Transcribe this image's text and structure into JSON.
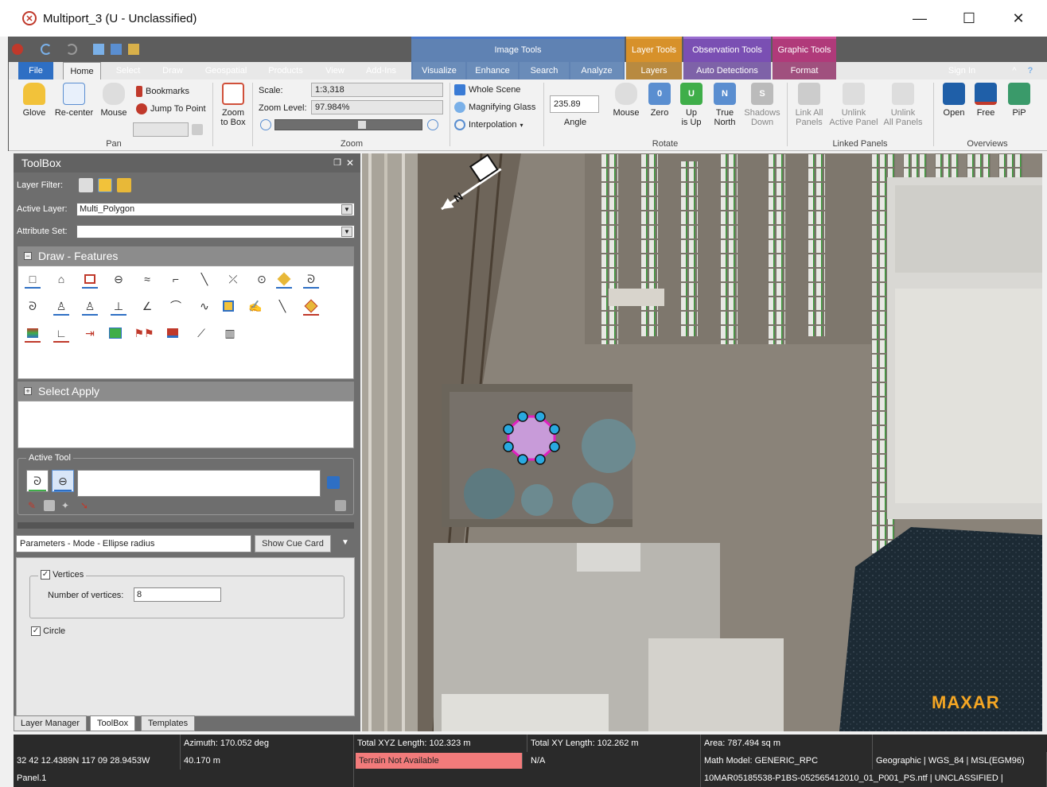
{
  "window": {
    "title": "Multiport_3 (U - Unclassified)",
    "minimize": "—",
    "maximize": "☐",
    "close": "✕"
  },
  "ribbon": {
    "context_groups": {
      "image_tools": "Image Tools",
      "layer_tools": "Layer Tools",
      "observation_tools": "Observation Tools",
      "graphic_tools": "Graphic Tools"
    },
    "tabs": [
      "File",
      "Home",
      "Select",
      "Draw",
      "Geospatial",
      "Products",
      "View",
      "Add-Ins",
      "Visualize",
      "Enhance",
      "Search",
      "Analyze",
      "Layers",
      "Auto Detections",
      "Format"
    ],
    "sign_in": "Sign In",
    "pan": {
      "label": "Pan",
      "glove": "Glove",
      "recenter": "Re-center",
      "mouse": "Mouse",
      "bookmarks": "Bookmarks",
      "jump_to_point": "Jump To Point"
    },
    "zoom": {
      "label": "Zoom",
      "zoom_to_box_1": "Zoom",
      "zoom_to_box_2": "to Box",
      "scale_label": "Scale:",
      "scale_value": "1:3,318",
      "zoom_level_label": "Zoom Level:",
      "zoom_level_value": "97.984%"
    },
    "view": {
      "whole_scene": "Whole Scene",
      "magnifying_glass": "Magnifying Glass",
      "interpolation": "Interpolation"
    },
    "rotate": {
      "label": "Rotate",
      "angle_value": "235.89",
      "angle": "Angle",
      "mouse": "Mouse",
      "zero": "Zero",
      "up_is_up_1": "Up",
      "up_is_up_2": "is Up",
      "true_north_1": "True",
      "true_north_2": "North",
      "shadows_down_1": "Shadows",
      "shadows_down_2": "Down"
    },
    "linked_panels": {
      "label": "Linked Panels",
      "link_all_1": "Link All",
      "link_all_2": "Panels",
      "unlink_active_1": "Unlink",
      "unlink_active_2": "Active Panel",
      "unlink_all_1": "Unlink",
      "unlink_all_2": "All Panels"
    },
    "overviews": {
      "label": "Overviews",
      "open": "Open",
      "free": "Free",
      "pip": "PiP"
    }
  },
  "toolbox": {
    "title": "ToolBox",
    "layer_filter_label": "Layer Filter:",
    "active_layer_label": "Active Layer:",
    "active_layer_value": "Multi_Polygon",
    "attribute_set_label": "Attribute Set:",
    "attribute_set_value": "",
    "draw_features": "Draw - Features",
    "select_apply": "Select Apply",
    "active_tool": "Active Tool",
    "parameters": "Parameters - Mode - Ellipse radius",
    "show_cue_card": "Show Cue Card",
    "vertices_label": "Vertices",
    "number_of_vertices_label": "Number of vertices:",
    "number_of_vertices_value": "8",
    "circle_label": "Circle"
  },
  "bottom_tabs": [
    "Layer Manager",
    "ToolBox",
    "Templates"
  ],
  "map": {
    "north_label": "N",
    "watermark": "MAXAR"
  },
  "status": {
    "azimuth": "Azimuth: 170.052 deg",
    "total_xyz": "Total XYZ Length: 102.323 m",
    "total_xy": "Total XY Length: 102.262 m",
    "area": "Area: 787.494 sq m",
    "coords": "32 42 12.4389N 117 09 28.9453W",
    "elevation": "40.170 m",
    "terrain": "Terrain Not Available",
    "na": "N/A",
    "math_model": "Math Model: GENERIC_RPC",
    "geographic": "Geographic | WGS_84 | MSL(EGM96)",
    "panel": "Panel.1",
    "filename": "10MAR05185538-P1BS-052565412010_01_P001_PS.ntf | UNCLASSIFIED |"
  },
  "colors": {
    "accent_blue": "#2e6fc4",
    "polygon_fill": "#c89bd9",
    "polygon_stroke": "#e020c0",
    "vertex": "#29a9e0",
    "terrain_bg": "#f27b7b",
    "maxar": "#f5a623"
  }
}
